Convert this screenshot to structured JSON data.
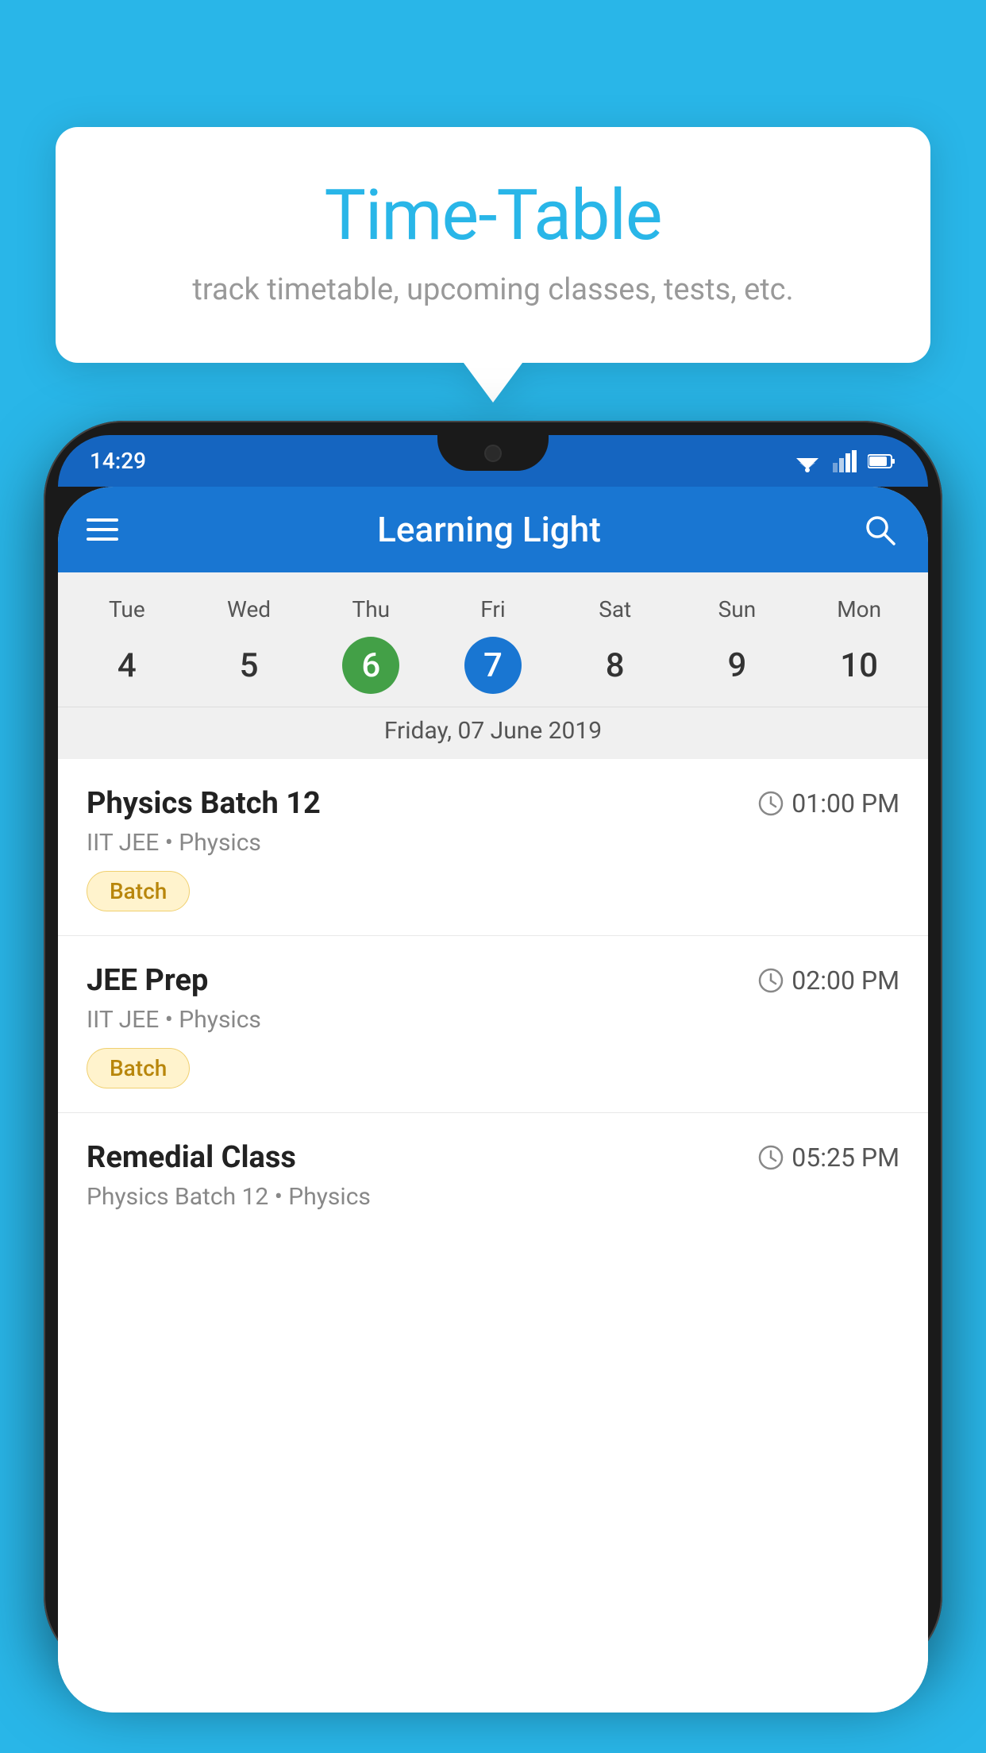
{
  "background_color": "#29B6E8",
  "tooltip": {
    "title": "Time-Table",
    "subtitle": "track timetable, upcoming classes, tests, etc."
  },
  "phone": {
    "status_bar": {
      "time": "14:29"
    },
    "app_bar": {
      "title": "Learning Light"
    },
    "calendar": {
      "days": [
        "Tue",
        "Wed",
        "Thu",
        "Fri",
        "Sat",
        "Sun",
        "Mon"
      ],
      "dates": [
        "4",
        "5",
        "6",
        "7",
        "8",
        "9",
        "10"
      ],
      "today_index": 2,
      "selected_index": 3,
      "date_label": "Friday, 07 June 2019"
    },
    "schedule": [
      {
        "title": "Physics Batch 12",
        "time": "01:00 PM",
        "meta": "IIT JEE • Physics",
        "badge": "Batch"
      },
      {
        "title": "JEE Prep",
        "time": "02:00 PM",
        "meta": "IIT JEE • Physics",
        "badge": "Batch"
      },
      {
        "title": "Remedial Class",
        "time": "05:25 PM",
        "meta": "Physics Batch 12 • Physics",
        "badge": null
      }
    ]
  }
}
